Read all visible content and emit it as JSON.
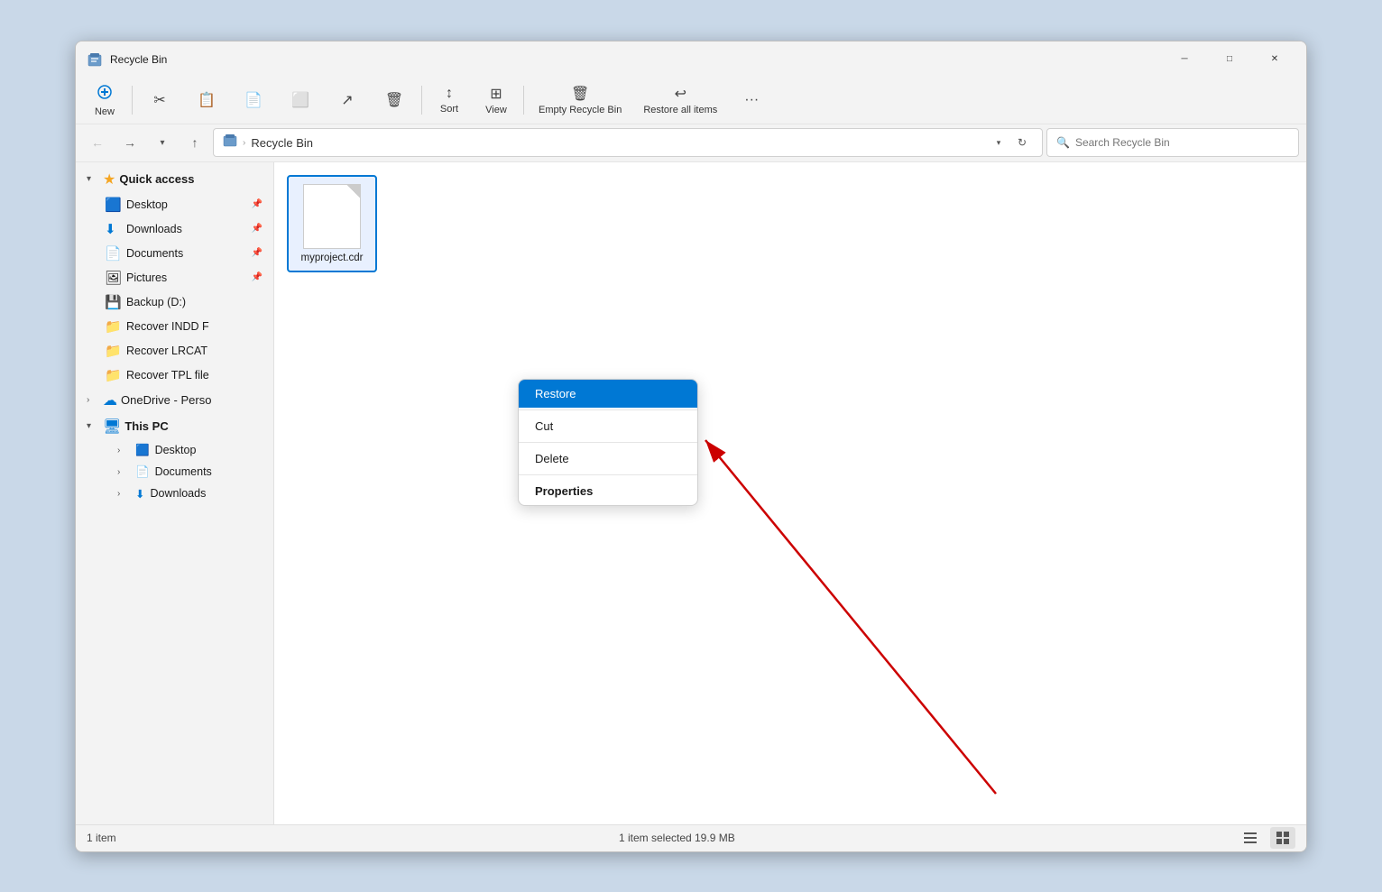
{
  "window": {
    "title": "Recycle Bin",
    "icon": "🗑️"
  },
  "window_controls": {
    "minimize": "─",
    "maximize": "□",
    "close": "✕"
  },
  "toolbar": {
    "new_label": "New",
    "sort_label": "Sort",
    "view_label": "View",
    "empty_recycle_bin_label": "Empty Recycle Bin",
    "restore_all_items_label": "Restore all items",
    "more_label": "···"
  },
  "address_bar": {
    "path_icon": "🗑️",
    "path_label": "Recycle Bin",
    "search_placeholder": "Search Recycle Bin"
  },
  "sidebar": {
    "quick_access_label": "Quick access",
    "quick_access_items": [
      {
        "icon": "🟦",
        "label": "Desktop",
        "pinned": true
      },
      {
        "icon": "⬇️",
        "label": "Downloads",
        "pinned": true
      },
      {
        "icon": "📄",
        "label": "Documents",
        "pinned": true
      },
      {
        "icon": "🖼️",
        "label": "Pictures",
        "pinned": true
      }
    ],
    "other_items": [
      {
        "icon": "💾",
        "label": "Backup (D:)",
        "pinned": false
      },
      {
        "icon": "📁",
        "label": "Recover INDD F",
        "pinned": false
      },
      {
        "icon": "📁",
        "label": "Recover LRCAT",
        "pinned": false
      },
      {
        "icon": "📁",
        "label": "Recover TPL file",
        "pinned": false
      }
    ],
    "onedrive_label": "OneDrive - Perso",
    "this_pc_label": "This PC",
    "this_pc_items": [
      {
        "icon": "🟦",
        "label": "Desktop"
      },
      {
        "icon": "📄",
        "label": "Documents"
      },
      {
        "icon": "⬇️",
        "label": "Downloads"
      }
    ]
  },
  "file": {
    "name": "myproject.cdr"
  },
  "context_menu": {
    "restore": "Restore",
    "cut": "Cut",
    "delete": "Delete",
    "properties": "Properties"
  },
  "status_bar": {
    "item_count": "1 item",
    "selected_info": "1 item selected  19.9 MB"
  }
}
